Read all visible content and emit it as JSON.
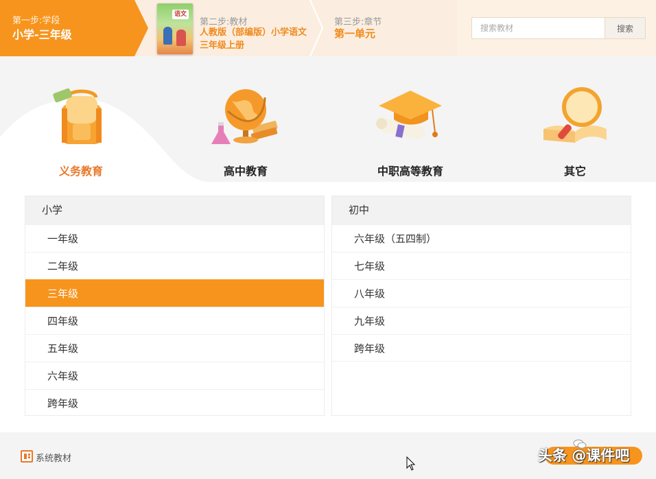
{
  "steps": {
    "step1": {
      "label": "第一步:学段",
      "value": "小学-三年级"
    },
    "step2": {
      "label": "第二步:教材",
      "value": "人教版（部编版）小学语文三年级上册",
      "cover_title": "语文"
    },
    "step3": {
      "label": "第三步:章节",
      "value": "第一单元"
    }
  },
  "search": {
    "placeholder": "搜索教材",
    "button": "搜索"
  },
  "categories": [
    {
      "label": "义务教育",
      "icon": "schoolbag-icon",
      "active": true
    },
    {
      "label": "高中教育",
      "icon": "globe-icon",
      "active": false
    },
    {
      "label": "中职高等教育",
      "icon": "graduation-cap-icon",
      "active": false
    },
    {
      "label": "其它",
      "icon": "magnifier-book-icon",
      "active": false
    }
  ],
  "panels": {
    "primary": {
      "title": "小学",
      "grades": [
        "一年级",
        "二年级",
        "三年级",
        "四年级",
        "五年级",
        "六年级",
        "跨年级"
      ],
      "selected_index": 2
    },
    "middle": {
      "title": "初中",
      "grades": [
        "六年级（五四制）",
        "七年级",
        "八年级",
        "九年级",
        "跨年级"
      ]
    }
  },
  "footer": {
    "system_label": "系统教材",
    "watermark": "头条 @课件吧"
  },
  "colors": {
    "accent": "#f7941d",
    "accent_text": "#e8782a",
    "band_bg": "#f4f4f4",
    "step_bg": "#fbeee0"
  }
}
